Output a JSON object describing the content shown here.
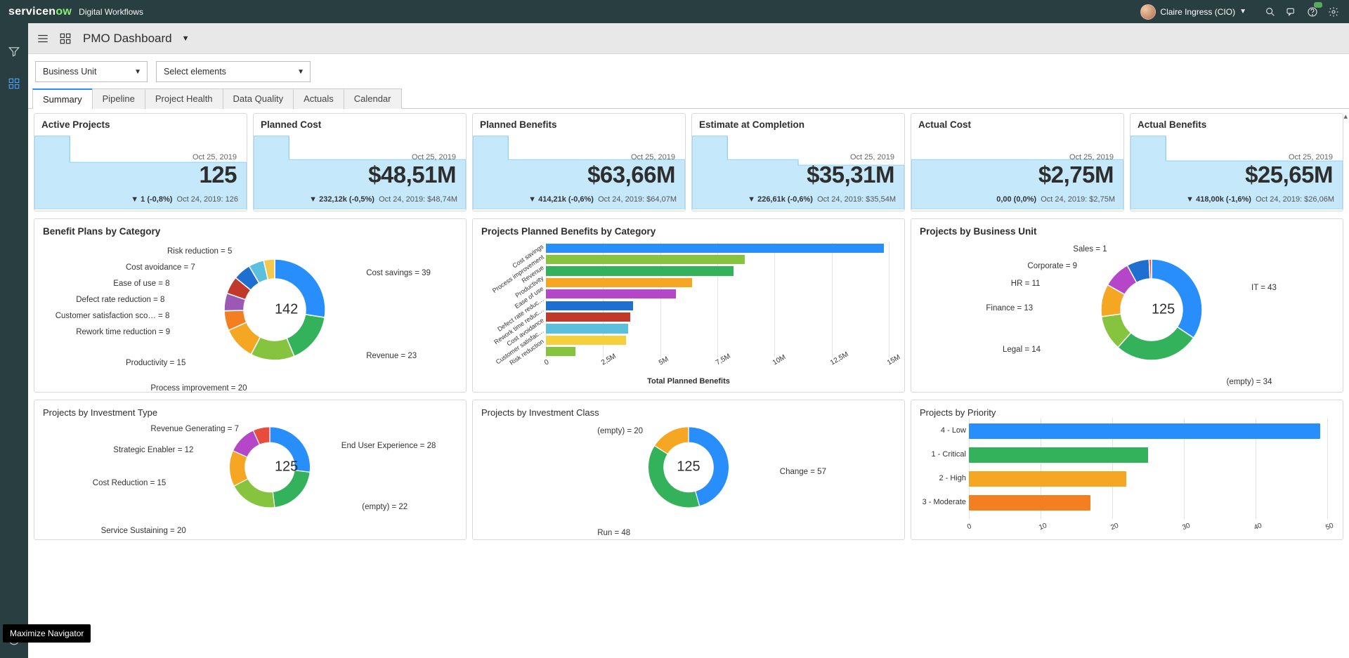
{
  "banner": {
    "brand_prefix": "servicen",
    "brand_suffix": "ow",
    "subbrand": "Digital Workflows",
    "user": "Claire Ingress (CIO)"
  },
  "tooltip": "Maximize Navigator",
  "page_title": "PMO Dashboard",
  "filters": {
    "dim": "Business Unit",
    "elem": "Select elements"
  },
  "tabs": [
    "Summary",
    "Pipeline",
    "Project Health",
    "Data Quality",
    "Actuals",
    "Calendar"
  ],
  "kpi": [
    {
      "title": "Active Projects",
      "date": "Oct 25, 2019",
      "value": "125",
      "delta": "▼ 1 (-0,8%)",
      "prev": "Oct 24, 2019: 126"
    },
    {
      "title": "Planned Cost",
      "date": "Oct 25, 2019",
      "value": "$48,51M",
      "delta": "▼ 232,12k (-0,5%)",
      "prev": "Oct 24, 2019: $48,74M"
    },
    {
      "title": "Planned Benefits",
      "date": "Oct 25, 2019",
      "value": "$63,66M",
      "delta": "▼ 414,21k (-0,6%)",
      "prev": "Oct 24, 2019: $64,07M"
    },
    {
      "title": "Estimate at Completion",
      "date": "Oct 25, 2019",
      "value": "$35,31M",
      "delta": "▼ 226,61k (-0,6%)",
      "prev": "Oct 24, 2019: $35,54M"
    },
    {
      "title": "Actual Cost",
      "date": "Oct 25, 2019",
      "value": "$2,75M",
      "delta": "0,00 (0,0%)",
      "prev": "Oct 24, 2019: $2,75M"
    },
    {
      "title": "Actual Benefits",
      "date": "Oct 25, 2019",
      "value": "$25,65M",
      "delta": "▼ 418,00k (-1,6%)",
      "prev": "Oct 24, 2019: $26,06M"
    }
  ],
  "chart_data": [
    {
      "id": "benefit_plans",
      "type": "pie",
      "title": "Benefit Plans by Category",
      "center": "142",
      "series": [
        {
          "name": "Cost savings",
          "value": 39,
          "color": "#278efc"
        },
        {
          "name": "Revenue",
          "value": 23,
          "color": "#33b25b"
        },
        {
          "name": "Process improvement",
          "value": 20,
          "color": "#86c440"
        },
        {
          "name": "Productivity",
          "value": 15,
          "color": "#f5a623"
        },
        {
          "name": "Rework time reduction",
          "value": 9,
          "color": "#f37f20"
        },
        {
          "name": "Customer satisfaction sco…",
          "value": 8,
          "color": "#9b59b6"
        },
        {
          "name": "Defect rate reduction",
          "value": 8,
          "color": "#c0392b"
        },
        {
          "name": "Ease of use",
          "value": 8,
          "color": "#1f6fd0"
        },
        {
          "name": "Cost avoidance",
          "value": 7,
          "color": "#5bc0de"
        },
        {
          "name": "Risk reduction",
          "value": 5,
          "color": "#f2c94c"
        }
      ]
    },
    {
      "id": "planned_benefits_cat",
      "type": "bar",
      "title": "Projects Planned Benefits by Category",
      "xlabel": "Total Planned Benefits",
      "xlim": [
        0,
        15
      ],
      "xticks": [
        "0",
        "2,5M",
        "5M",
        "7,5M",
        "10M",
        "12,5M",
        "15M"
      ],
      "categories": [
        "Cost savings",
        "Process improvement",
        "Revenue",
        "Productivity",
        "Ease of use",
        "Defect rate reduc…",
        "Rework time reduc…",
        "Cost avoidance",
        "Customer satisfac…",
        "Risk reduction"
      ],
      "values": [
        14.8,
        8.7,
        8.2,
        6.4,
        5.7,
        3.8,
        3.7,
        3.6,
        3.5,
        1.3
      ],
      "colors": [
        "#278efc",
        "#86c440",
        "#33b25b",
        "#f5a623",
        "#b646c8",
        "#1f6fd0",
        "#c0392b",
        "#5bc0de",
        "#f4d03f",
        "#86c440"
      ]
    },
    {
      "id": "by_bu",
      "type": "pie",
      "title": "Projects by Business Unit",
      "center": "125",
      "series": [
        {
          "name": "IT",
          "value": 43,
          "color": "#278efc"
        },
        {
          "name": "(empty)",
          "value": 34,
          "color": "#33b25b"
        },
        {
          "name": "Legal",
          "value": 14,
          "color": "#86c440"
        },
        {
          "name": "Finance",
          "value": 13,
          "color": "#f5a623"
        },
        {
          "name": "HR",
          "value": 11,
          "color": "#b646c8"
        },
        {
          "name": "Corporate",
          "value": 9,
          "color": "#1f6fd0"
        },
        {
          "name": "Sales",
          "value": 1,
          "color": "#e74c3c"
        }
      ]
    },
    {
      "id": "by_inv_type",
      "type": "pie",
      "title": "Projects by Investment Type",
      "center": "125",
      "series": [
        {
          "name": "End User Experience",
          "value": 28,
          "color": "#278efc"
        },
        {
          "name": "(empty)",
          "value": 22,
          "color": "#33b25b"
        },
        {
          "name": "Service Sustaining",
          "value": 20,
          "color": "#86c440"
        },
        {
          "name": "Cost Reduction",
          "value": 15,
          "color": "#f5a623"
        },
        {
          "name": "Strategic Enabler",
          "value": 12,
          "color": "#b646c8"
        },
        {
          "name": "Revenue Generating",
          "value": 7,
          "color": "#e74c3c"
        }
      ]
    },
    {
      "id": "by_inv_class",
      "type": "pie",
      "title": "Projects by Investment Class",
      "center": "125",
      "series": [
        {
          "name": "Change",
          "value": 57,
          "color": "#278efc"
        },
        {
          "name": "Run",
          "value": 48,
          "color": "#33b25b"
        },
        {
          "name": "(empty)",
          "value": 20,
          "color": "#f5a623"
        }
      ]
    },
    {
      "id": "by_priority",
      "type": "bar",
      "title": "Projects by Priority",
      "xlim": [
        0,
        50
      ],
      "xticks": [
        "0",
        "10",
        "20",
        "30",
        "40",
        "50"
      ],
      "categories": [
        "4 - Low",
        "1 - Critical",
        "2 - High",
        "3 - Moderate"
      ],
      "values": [
        49,
        25,
        22,
        17
      ],
      "colors": [
        "#278efc",
        "#33b25b",
        "#f5a623",
        "#f37f20"
      ]
    }
  ]
}
